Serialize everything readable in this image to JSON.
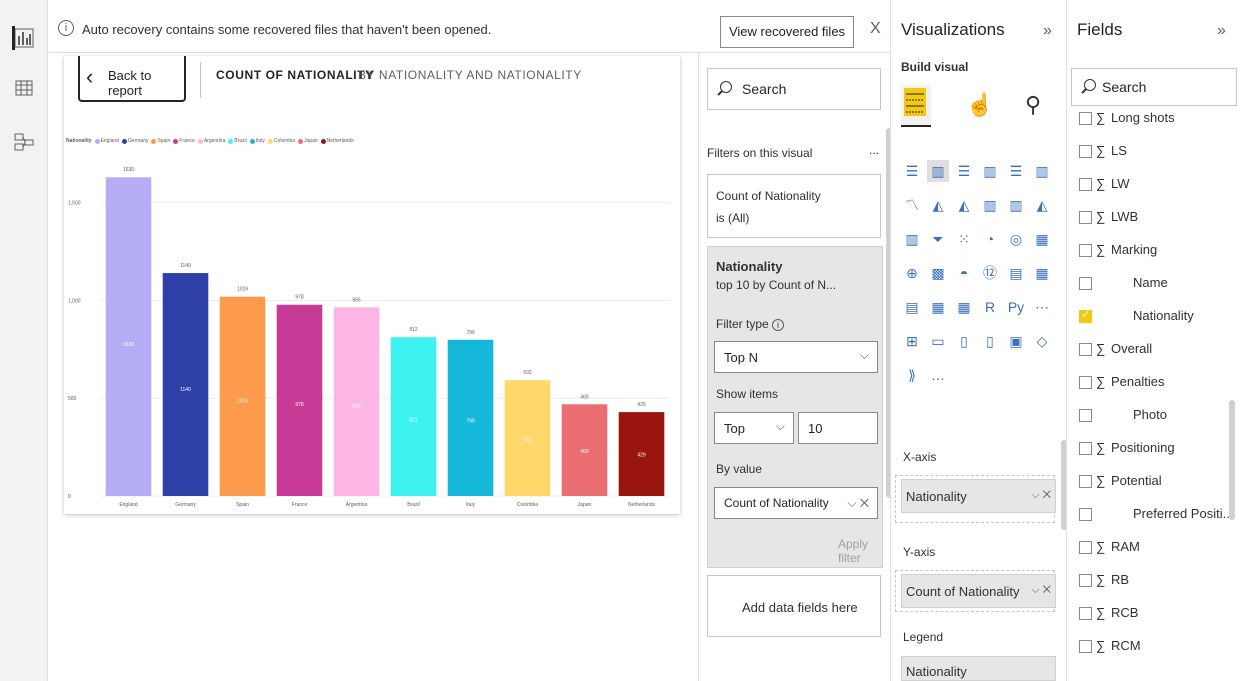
{
  "banner": {
    "text": "Auto recovery contains some recovered files that haven't been opened.",
    "button": "View recovered files",
    "close": "X"
  },
  "visual": {
    "back_label": "Back to report",
    "title": "COUNT OF NATIONALITY",
    "subtitle": "BY NATIONALITY AND NATIONALITY",
    "legend_title": "Nationality"
  },
  "chart_data": {
    "type": "bar",
    "categories": [
      "England",
      "Germany",
      "Spain",
      "France",
      "Argentina",
      "Brazil",
      "Italy",
      "Colombia",
      "Japan",
      "Netherlands"
    ],
    "values": [
      1630,
      1140,
      1019,
      978,
      965,
      812,
      799,
      592,
      469,
      429
    ],
    "colors": [
      "#b6aef5",
      "#2f3fa8",
      "#fe9a4c",
      "#c73b96",
      "#fcb6e6",
      "#3ff2f2",
      "#16b8d9",
      "#ffd76b",
      "#eb6f72",
      "#9a1510"
    ],
    "ylim": [
      0,
      1800
    ],
    "yticks": [
      0,
      500,
      1000,
      1500
    ],
    "ytick_labels": [
      "0",
      "500",
      "1,000",
      "1,500"
    ],
    "grid": true,
    "legend": "top-left"
  },
  "filters": {
    "search_placeholder": "Search",
    "section_label": "Filters on this visual",
    "more": "...",
    "card1_title": "Count of Nationality",
    "card1_value": "is (All)",
    "card2_title": "Nationality",
    "card2_summary": "top 10 by Count of N...",
    "filter_type_label": "Filter type",
    "filter_type_value": "Top N",
    "show_items_label": "Show items",
    "show_items_dir": "Top",
    "show_items_count": "10",
    "by_value_label": "By value",
    "by_value_field": "Count of Nationality",
    "apply": "Apply filter",
    "add_fields": "Add data fields here"
  },
  "viz": {
    "title": "Visualizations",
    "build_label": "Build visual",
    "x_axis_label": "X-axis",
    "x_axis_field": "Nationality",
    "y_axis_label": "Y-axis",
    "y_axis_field": "Count of Nationality",
    "legend_label": "Legend",
    "legend_field": "Nationality",
    "more": "..."
  },
  "fields": {
    "title": "Fields",
    "search_placeholder": "Search",
    "items": [
      {
        "name": "Long shots",
        "sigma": true,
        "checked": false
      },
      {
        "name": "LS",
        "sigma": true,
        "checked": false
      },
      {
        "name": "LW",
        "sigma": true,
        "checked": false
      },
      {
        "name": "LWB",
        "sigma": true,
        "checked": false
      },
      {
        "name": "Marking",
        "sigma": true,
        "checked": false
      },
      {
        "name": "Name",
        "sigma": false,
        "checked": false
      },
      {
        "name": "Nationality",
        "sigma": false,
        "checked": true
      },
      {
        "name": "Overall",
        "sigma": true,
        "checked": false
      },
      {
        "name": "Penalties",
        "sigma": true,
        "checked": false
      },
      {
        "name": "Photo",
        "sigma": false,
        "checked": false
      },
      {
        "name": "Positioning",
        "sigma": true,
        "checked": false
      },
      {
        "name": "Potential",
        "sigma": true,
        "checked": false
      },
      {
        "name": "Preferred Positi...",
        "sigma": false,
        "checked": false
      },
      {
        "name": "RAM",
        "sigma": true,
        "checked": false
      },
      {
        "name": "RB",
        "sigma": true,
        "checked": false
      },
      {
        "name": "RCB",
        "sigma": true,
        "checked": false
      },
      {
        "name": "RCM",
        "sigma": true,
        "checked": false
      }
    ]
  }
}
